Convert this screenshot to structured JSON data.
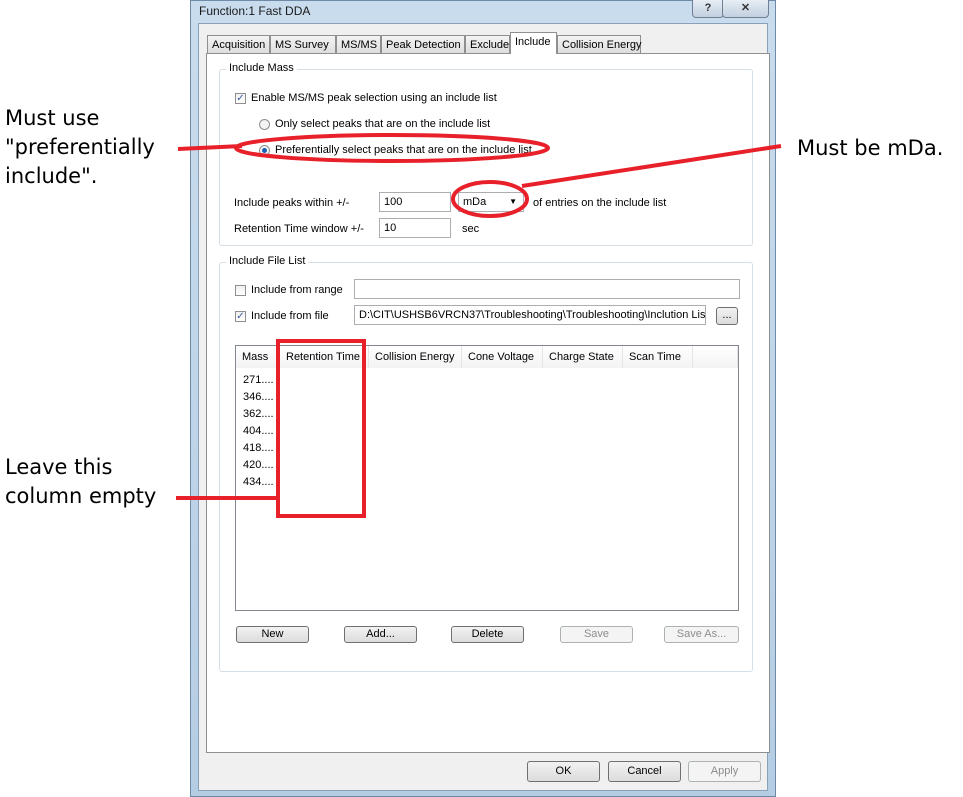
{
  "window": {
    "title": "Function:1 Fast DDA",
    "help_label": "?",
    "close_label": "✕"
  },
  "tabs": [
    {
      "label": "Acquisition"
    },
    {
      "label": "MS Survey"
    },
    {
      "label": "MS/MS"
    },
    {
      "label": "Peak Detection"
    },
    {
      "label": "Exclude"
    },
    {
      "label": "Include",
      "active": true
    },
    {
      "label": "Collision Energy"
    }
  ],
  "include_mass": {
    "title": "Include Mass",
    "enable_label": "Enable MS/MS peak selection using an include list",
    "enable_checked": true,
    "only_label": "Only select peaks that are on the include list",
    "pref_label": "Preferentially select peaks that are on the include list",
    "selected": "preferentially",
    "within_label": "Include peaks within +/-",
    "within_value": "100",
    "unit": "mDa",
    "within_suffix": "of entries on the include list",
    "rt_label": "Retention Time window +/-",
    "rt_value": "10",
    "rt_unit": "sec"
  },
  "file_list": {
    "title": "Include File List",
    "range_label": "Include from range",
    "range_checked": false,
    "range_value": "",
    "file_label": "Include from file",
    "file_checked": true,
    "file_value": "D:\\CIT\\USHSB6VRCN37\\Troubleshooting\\Troubleshooting\\Inclution Lis",
    "browse_label": "...",
    "columns": [
      "Mass",
      "Retention Time",
      "Collision Energy",
      "Cone Voltage",
      "Charge State",
      "Scan Time"
    ],
    "rows": [
      "271....",
      "346....",
      "362....",
      "404....",
      "418....",
      "420....",
      "434...."
    ],
    "buttons": {
      "new": "New",
      "add": "Add...",
      "delete": "Delete",
      "save": "Save",
      "save_as": "Save As..."
    }
  },
  "footer": {
    "ok": "OK",
    "cancel": "Cancel",
    "apply": "Apply"
  },
  "annotations": {
    "pref_note": [
      "Must use",
      "\"preferentially",
      "include\"."
    ],
    "unit_note": "Must be mDa.",
    "column_note": [
      "Leave this",
      "column empty"
    ],
    "color": "#e8202a"
  }
}
